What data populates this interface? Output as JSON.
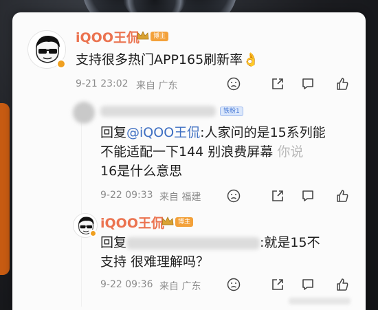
{
  "main_comment": {
    "author": "iQOO王侃",
    "badge": "博主",
    "text": "支持很多热门APP165刷新率",
    "emoji": "👌",
    "time": "9-21 23:02",
    "location": "来自 广东"
  },
  "reply1": {
    "badge": "铁粉1",
    "prefix": "回复",
    "mention": "@iQOO王侃",
    "line1_rest": ":人家问的是15系列能",
    "line2": "不能适配一下144  别浪费屏幕",
    "line2_faded": "你说",
    "line3": "16是什么意思",
    "time": "9-22 09:33",
    "location": "来自 福建"
  },
  "reply2": {
    "author": "iQOO王侃",
    "badge": "博主",
    "prefix": "回复",
    "line1_rest": ":就是15不",
    "line2": "支持 很难理解吗？",
    "time": "9-22 09:36",
    "location": "来自 广东"
  },
  "icons": [
    "dislike-icon",
    "share-icon",
    "comment-icon",
    "like-icon"
  ],
  "colors": {
    "author": "#eb7350",
    "link": "#3e6fc2",
    "meta": "#8c8c8c",
    "badge": "#f3a13a"
  }
}
